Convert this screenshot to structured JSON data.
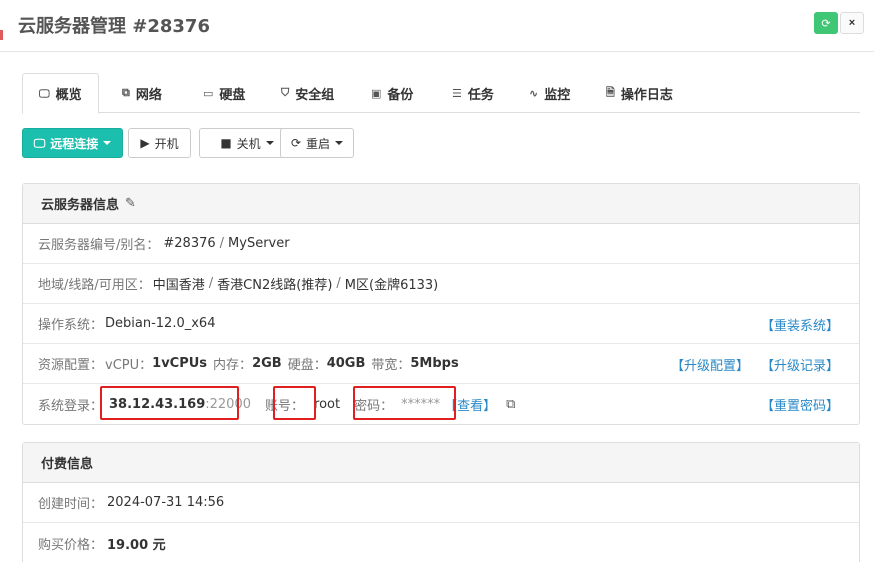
{
  "header": {
    "title": "云服务器管理 #28376",
    "refresh_icon": "refresh-icon",
    "close_label": "×"
  },
  "tabs": [
    {
      "label": "概览",
      "icon": "monitor-icon",
      "glyph": "🖵"
    },
    {
      "label": "网络",
      "icon": "network-icon",
      "glyph": "⧉"
    },
    {
      "label": "硬盘",
      "icon": "hdd-icon",
      "glyph": "▭"
    },
    {
      "label": "安全组",
      "icon": "shield-icon",
      "glyph": "⛉"
    },
    {
      "label": "备份",
      "icon": "save-icon",
      "glyph": "▣"
    },
    {
      "label": "任务",
      "icon": "tasks-icon",
      "glyph": "☰"
    },
    {
      "label": "监控",
      "icon": "pulse-icon",
      "glyph": "∿"
    },
    {
      "label": "操作日志",
      "icon": "file-icon",
      "glyph": "🗎"
    }
  ],
  "toolbar": {
    "remote": "远程连接",
    "start": "开机",
    "shutdown": "关机",
    "restart": "重启"
  },
  "info": {
    "title": "云服务器信息",
    "id_label": "云服务器编号/别名：",
    "id_value": "#28376",
    "alias": "MyServer",
    "region_label": "地域/线路/可用区：",
    "region": "中国香港",
    "line": "香港CN2线路(推荐)",
    "zone": "M区(金牌6133)",
    "os_label": "操作系统：",
    "os": "Debian-12.0_x64",
    "reinstall": "【重装系统】",
    "config_label": "资源配置：",
    "vcpu_label": "vCPU：",
    "vcpu": "1vCPUs",
    "mem_label": "内存：",
    "mem": "2GB",
    "disk_label": "硬盘：",
    "disk": "40GB",
    "bw_label": "带宽：",
    "bw": "5Mbps",
    "upgrade": "【升级配置】",
    "upgrade_log": "【升级记录】",
    "login_label": "系统登录：",
    "ip": "38.12.43.169",
    "port": ":22000",
    "account_label": "账号：",
    "account": "root",
    "pwd_label": "密码：",
    "pwd_mask": "******",
    "view": "【查看】",
    "reset_pwd": "【重置密码】"
  },
  "billing": {
    "title": "付费信息",
    "created_label": "创建时间：",
    "created": "2024-07-31 14:56",
    "price_label": "购买价格：",
    "price": "19.00 元"
  },
  "colors": {
    "primary": "#1cbfae",
    "link": "#2a8ac8",
    "highlight": "#e02020",
    "refresh": "#3fc776"
  }
}
